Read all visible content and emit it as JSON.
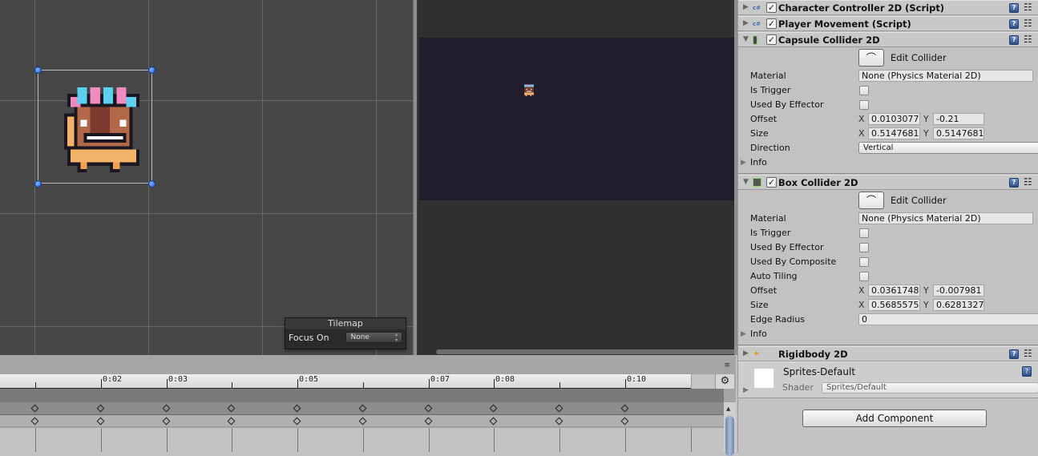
{
  "scene": {
    "tilemap_overlay": {
      "title": "Tilemap",
      "focus_label": "Focus On",
      "focus_value": "None"
    }
  },
  "timeline": {
    "tick_labels": [
      "0:02",
      "0:03",
      "0:05",
      "0:07",
      "0:08",
      "0:10"
    ],
    "menu_icon": "≡",
    "gear_icon": "⚙"
  },
  "inspector": {
    "components": [
      {
        "name": "Character Controller 2D (Script)",
        "icon": "cs-script-icon",
        "enabled": true,
        "expanded": false
      },
      {
        "name": "Player Movement (Script)",
        "icon": "cs-script-icon",
        "enabled": true,
        "expanded": false
      },
      {
        "name": "Capsule Collider 2D",
        "icon": "capsule-collider-icon",
        "enabled": true,
        "expanded": true
      },
      {
        "name": "Box Collider 2D",
        "icon": "box-collider-icon",
        "enabled": true,
        "expanded": true
      },
      {
        "name": "Rigidbody 2D",
        "icon": "rigidbody-icon",
        "expanded": false
      }
    ],
    "capsule": {
      "edit_collider": "Edit Collider",
      "material_label": "Material",
      "material_value": "None (Physics Material 2D)",
      "is_trigger_label": "Is Trigger",
      "is_trigger": false,
      "used_by_effector_label": "Used By Effector",
      "used_by_effector": false,
      "offset_label": "Offset",
      "offset_x": "0.0103077",
      "offset_y": "-0.21",
      "size_label": "Size",
      "size_x": "0.5147681",
      "size_y": "0.5147681",
      "direction_label": "Direction",
      "direction_value": "Vertical",
      "info_label": "Info"
    },
    "box": {
      "edit_collider": "Edit Collider",
      "material_label": "Material",
      "material_value": "None (Physics Material 2D)",
      "is_trigger_label": "Is Trigger",
      "is_trigger": false,
      "used_by_effector_label": "Used By Effector",
      "used_by_effector": false,
      "used_by_composite_label": "Used By Composite",
      "used_by_composite": false,
      "auto_tiling_label": "Auto Tiling",
      "auto_tiling": false,
      "offset_label": "Offset",
      "offset_x": "0.0361748",
      "offset_y": "-0.007981",
      "size_label": "Size",
      "size_x": "0.5685575",
      "size_y": "0.6281327",
      "edge_radius_label": "Edge Radius",
      "edge_radius": "0",
      "info_label": "Info"
    },
    "xy": {
      "x": "X",
      "y": "Y"
    },
    "material": {
      "name": "Sprites-Default",
      "shader_label": "Shader",
      "shader_value": "Sprites/Default"
    },
    "add_component_label": "Add Component"
  }
}
